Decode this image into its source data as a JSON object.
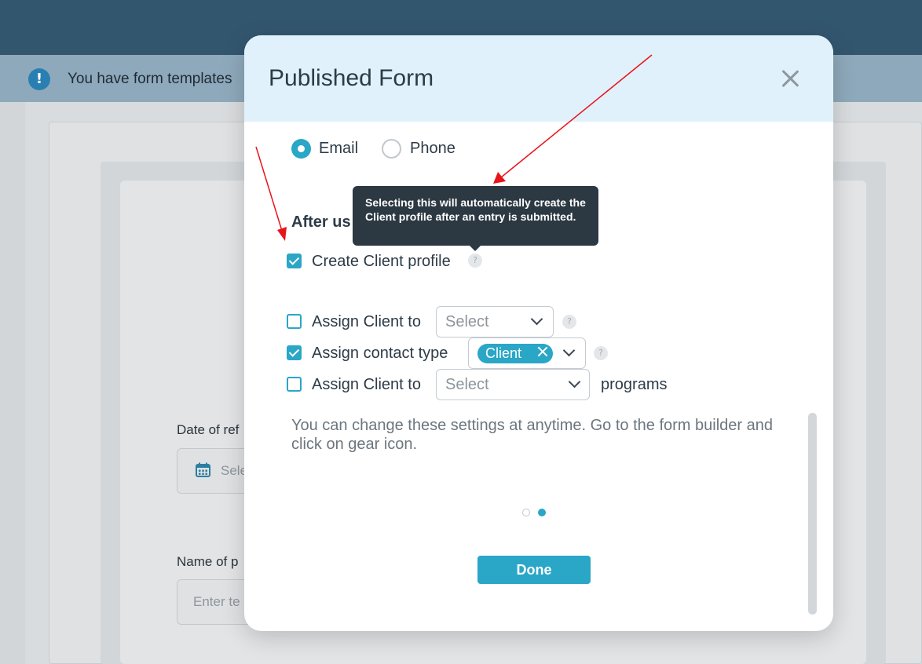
{
  "notice": {
    "text": "You have form templates",
    "icon": "exclamation-icon"
  },
  "background_form": {
    "date_label": "Date of ref",
    "date_placeholder": "Sele",
    "name_label": "Name of p",
    "name_placeholder": "Enter te"
  },
  "modal": {
    "title": "Published Form",
    "contact_method": {
      "options": [
        "Email",
        "Phone"
      ],
      "selected": "Email"
    },
    "section_heading": "After us",
    "tooltip": "Selecting this will automatically create the Client profile after an entry is submitted.",
    "options": {
      "create_client_profile": {
        "label": "Create Client profile",
        "checked": true
      },
      "assign_client_to": {
        "label": "Assign Client to",
        "checked": false,
        "select_placeholder": "Select"
      },
      "assign_contact_type": {
        "label": "Assign contact type",
        "checked": true,
        "chip": "Client"
      },
      "assign_client_programs": {
        "label": "Assign Client to",
        "checked": false,
        "select_placeholder": "Select",
        "suffix": "programs"
      }
    },
    "hint": "You can change these settings at anytime. Go to the form builder and click on gear icon.",
    "pagination": {
      "pages": 2,
      "current": 2
    },
    "done_label": "Done"
  },
  "help_icon_glyph": "?",
  "colors": {
    "accent": "#2aa6c6",
    "header_bg": "#e0f1fb",
    "topbar": "#33566f",
    "tooltip_bg": "#2c3842",
    "annotation_arrow": "#e8141c"
  }
}
